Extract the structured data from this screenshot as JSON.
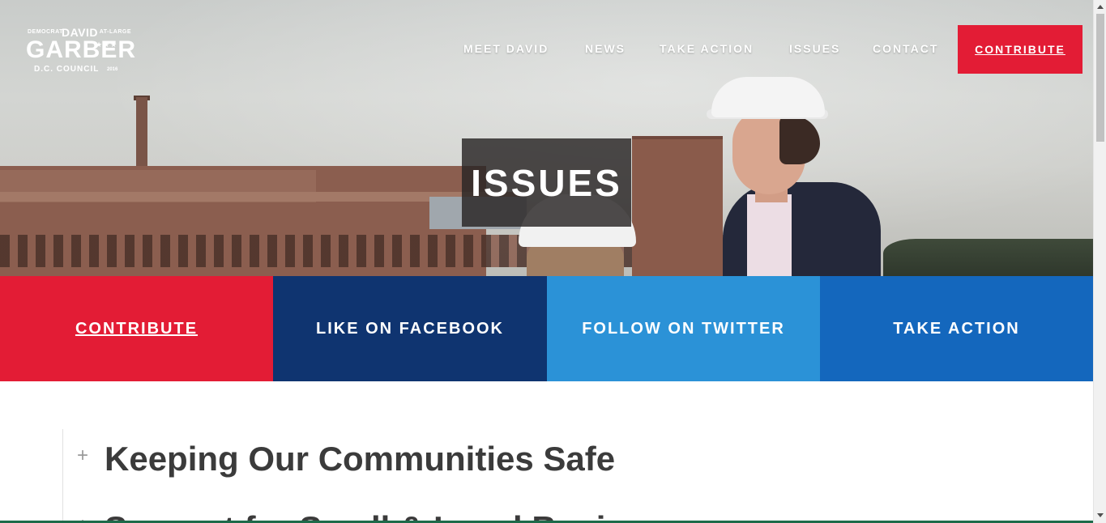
{
  "logo": {
    "left_small": "DEMOCRAT",
    "name_top": "DAVID",
    "right_small": "AT-LARGE",
    "name_main": "GARBER",
    "stars": "★★★",
    "council": "D.C. COUNCIL",
    "year": "2016"
  },
  "nav": {
    "items": [
      {
        "label": "MEET DAVID"
      },
      {
        "label": "NEWS"
      },
      {
        "label": "TAKE ACTION"
      },
      {
        "label": "ISSUES"
      },
      {
        "label": "CONTACT"
      }
    ],
    "contribute": "CONTRIBUTE"
  },
  "hero": {
    "title": "ISSUES"
  },
  "cta": [
    {
      "label": "CONTRIBUTE",
      "color": "#e31c35"
    },
    {
      "label": "LIKE ON FACEBOOK",
      "color": "#0f3470"
    },
    {
      "label": "FOLLOW ON TWITTER",
      "color": "#2b92d7"
    },
    {
      "label": "TAKE ACTION",
      "color": "#1467bd"
    }
  ],
  "issues": [
    {
      "icon": "+",
      "title": "Keeping Our Communities Safe"
    },
    {
      "icon": "+",
      "title": "Support for Small & Local Businesses"
    }
  ]
}
